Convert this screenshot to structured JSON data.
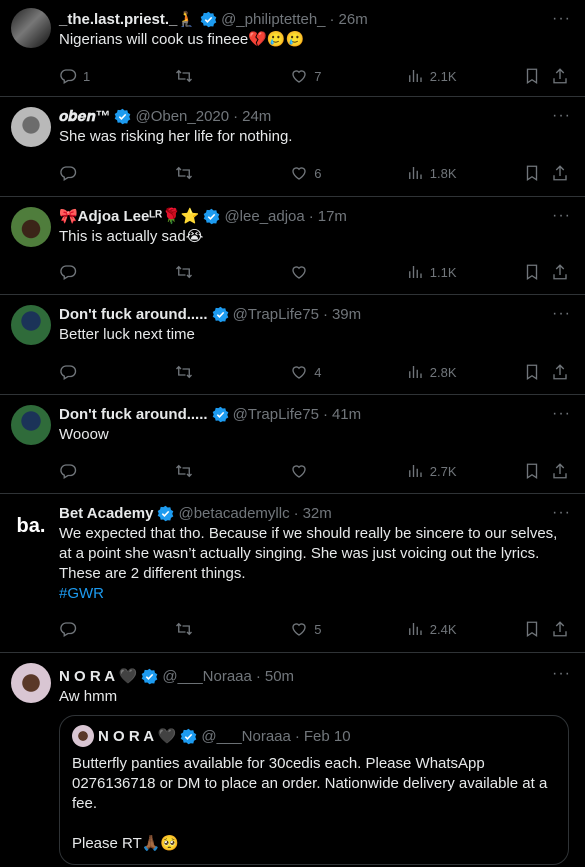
{
  "tweets": [
    {
      "name": "_the.last.priest._🧎",
      "handle": "@_philiptetteh_",
      "time": "26m",
      "text": "Nigerians will cook us fineee💔🥲🥲",
      "reply_count": "1",
      "retweet_count": "",
      "like_count": "7",
      "views": "2.1K"
    },
    {
      "name": "𝒐𝒃𝒆𝒏™",
      "handle": "@Oben_2020",
      "time": "24m",
      "text": "She was risking her life for nothing.",
      "reply_count": "",
      "retweet_count": "",
      "like_count": "6",
      "views": "1.8K"
    },
    {
      "name": "🎀Adjoa Leeᴸᴿ🌹⭐",
      "handle": "@lee_adjoa",
      "time": "17m",
      "text": "This is actually sad😭",
      "reply_count": "",
      "retweet_count": "",
      "like_count": "",
      "views": "1.1K"
    },
    {
      "name": "Don't fuck around.....",
      "handle": "@TrapLife75",
      "time": "39m",
      "text": "Better luck next time",
      "reply_count": "",
      "retweet_count": "",
      "like_count": "4",
      "views": "2.8K"
    },
    {
      "name": "Don't fuck around.....",
      "handle": "@TrapLife75",
      "time": "41m",
      "text": "Wooow",
      "reply_count": "",
      "retweet_count": "",
      "like_count": "",
      "views": "2.7K"
    },
    {
      "name": "Bet Academy",
      "handle": "@betacademyllc",
      "time": "32m",
      "text": "We expected that tho. Because if we should really be sincere to our selves, at a point she wasn’t actually singing. She was just voicing out the lyrics. These are 2 different things.",
      "hashtag": "#GWR",
      "avatar_text": "ba.",
      "reply_count": "",
      "retweet_count": "",
      "like_count": "5",
      "views": "2.4K"
    },
    {
      "name": "N O R A 🖤",
      "handle": "@___Noraaa",
      "time": "50m",
      "text": "Aw hmm",
      "quote": {
        "name": "N O R A 🖤",
        "handle": "@___Noraaa",
        "time": "Feb 10",
        "text": "Butterfly panties available for 30cedis each. Please WhatsApp 0276136718 or DM to place an order. Nationwide delivery available at a fee.",
        "text2": "Please RT🙏🏾🥺"
      }
    }
  ],
  "dot": "·",
  "more_icon": "···",
  "colors": {
    "accent": "#1d9bf0",
    "muted": "#71767b",
    "divider": "#2f3336",
    "bg": "#000000"
  },
  "icons": [
    "reply-icon",
    "retweet-icon",
    "like-icon",
    "views-icon",
    "bookmark-icon",
    "share-icon",
    "verified-icon",
    "more-icon"
  ]
}
